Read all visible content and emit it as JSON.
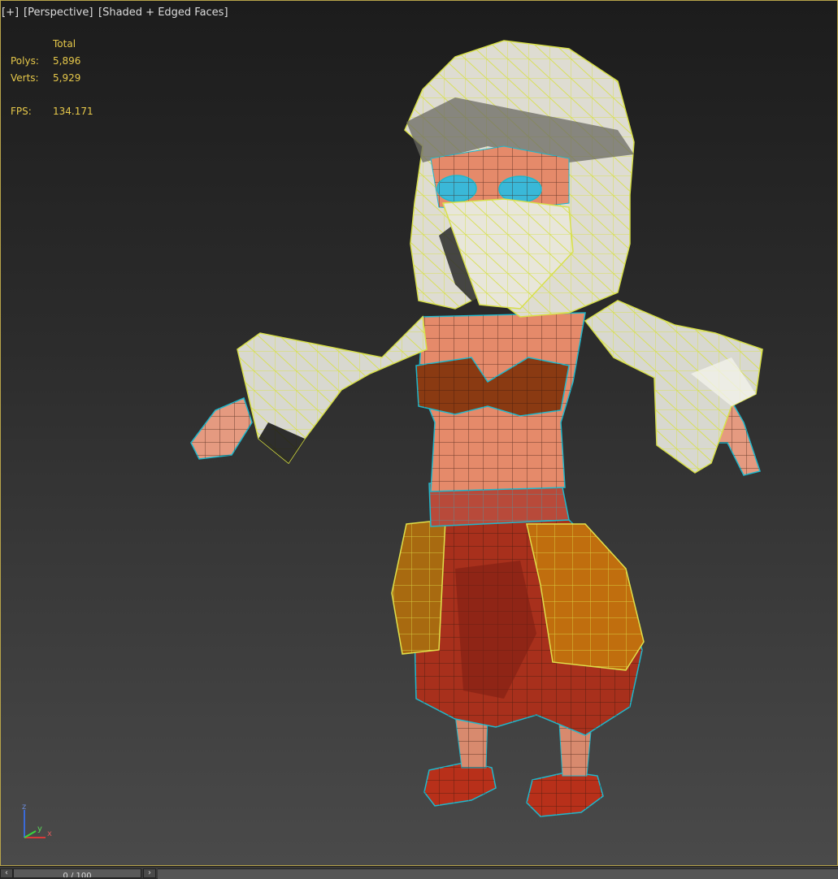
{
  "viewport": {
    "labels": {
      "plus": "[+]",
      "view": "[Perspective]",
      "shading": "[Shaded + Edged Faces]"
    },
    "stats": {
      "header": "Total",
      "polys_label": "Polys:",
      "polys_value": "5,896",
      "verts_label": "Verts:",
      "verts_value": "5,929",
      "fps_label": "FPS:",
      "fps_value": "134.171"
    },
    "axis": {
      "z": "z",
      "x": "x",
      "y": "y"
    },
    "colors": {
      "frame_border": "#b8a44a",
      "stats_text": "#e6c84a",
      "selected_wire": "#d8e04a",
      "skin_wire": "#1fb8cc"
    }
  },
  "timeline": {
    "frame_display": "0 / 100",
    "prev_icon": "chevron-left-icon",
    "next_icon": "chevron-right-icon"
  }
}
